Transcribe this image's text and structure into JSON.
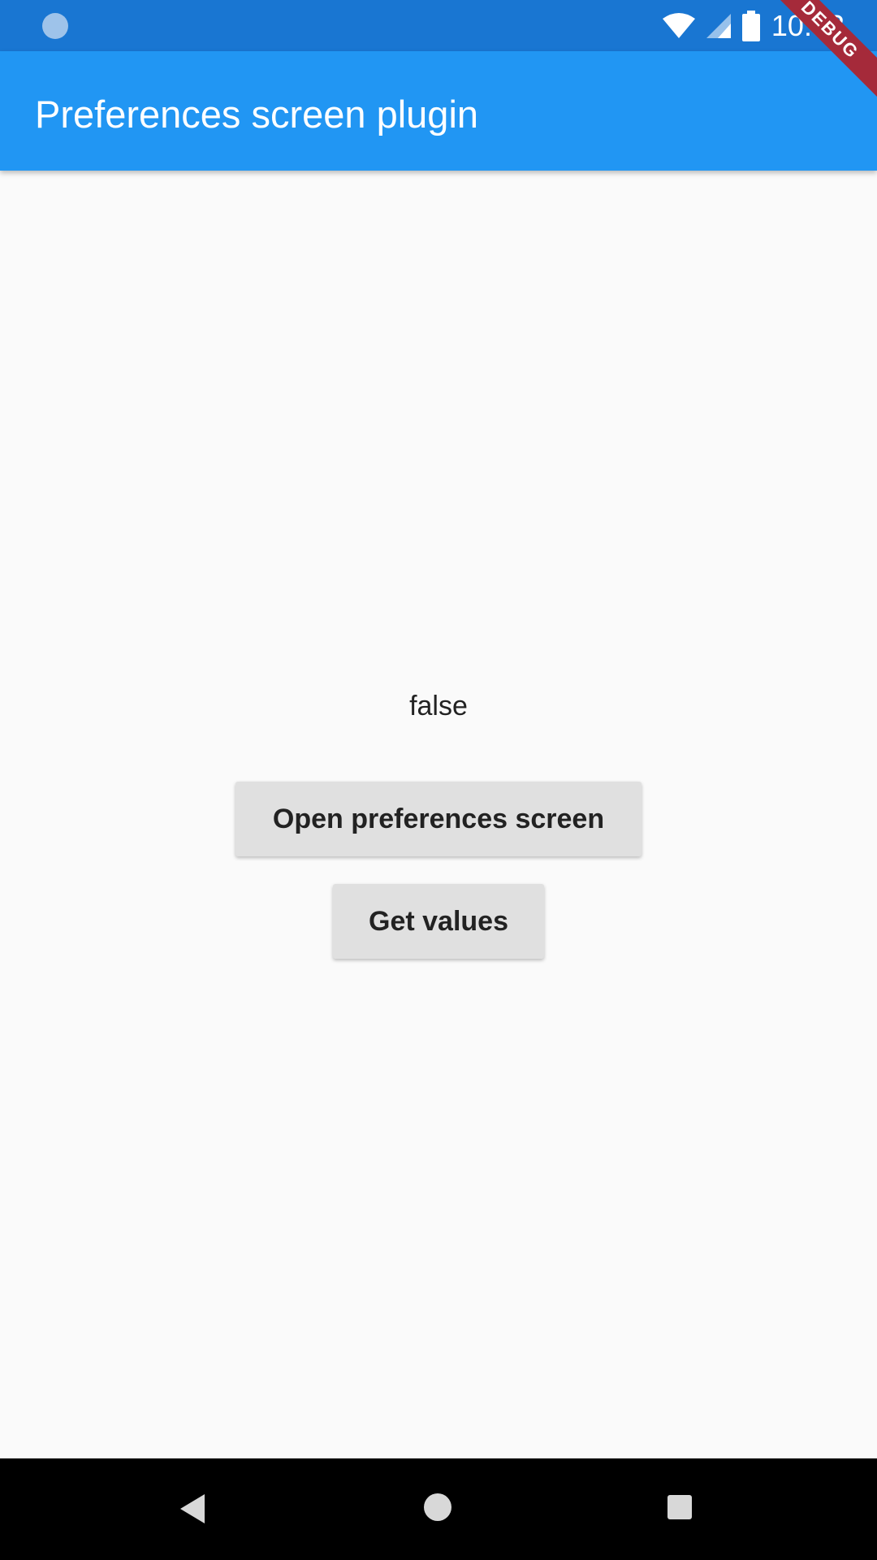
{
  "status_bar": {
    "time": "10:53",
    "icons": [
      "notification-dot-icon",
      "wifi-icon",
      "signal-icon",
      "battery-icon"
    ]
  },
  "app_bar": {
    "title": "Preferences screen plugin"
  },
  "debug_banner": {
    "label": "DEBUG"
  },
  "main": {
    "value_text": "false",
    "open_button_label": "Open preferences screen",
    "get_values_button_label": "Get values"
  },
  "nav_bar": {
    "icons": [
      "back-icon",
      "home-icon",
      "recent-apps-icon"
    ]
  },
  "colors": {
    "status_bar": "#1976d2",
    "app_bar": "#2196f3",
    "background": "#fafafa",
    "button": "#e0e0e0",
    "debug_banner": "#a52a3a"
  }
}
